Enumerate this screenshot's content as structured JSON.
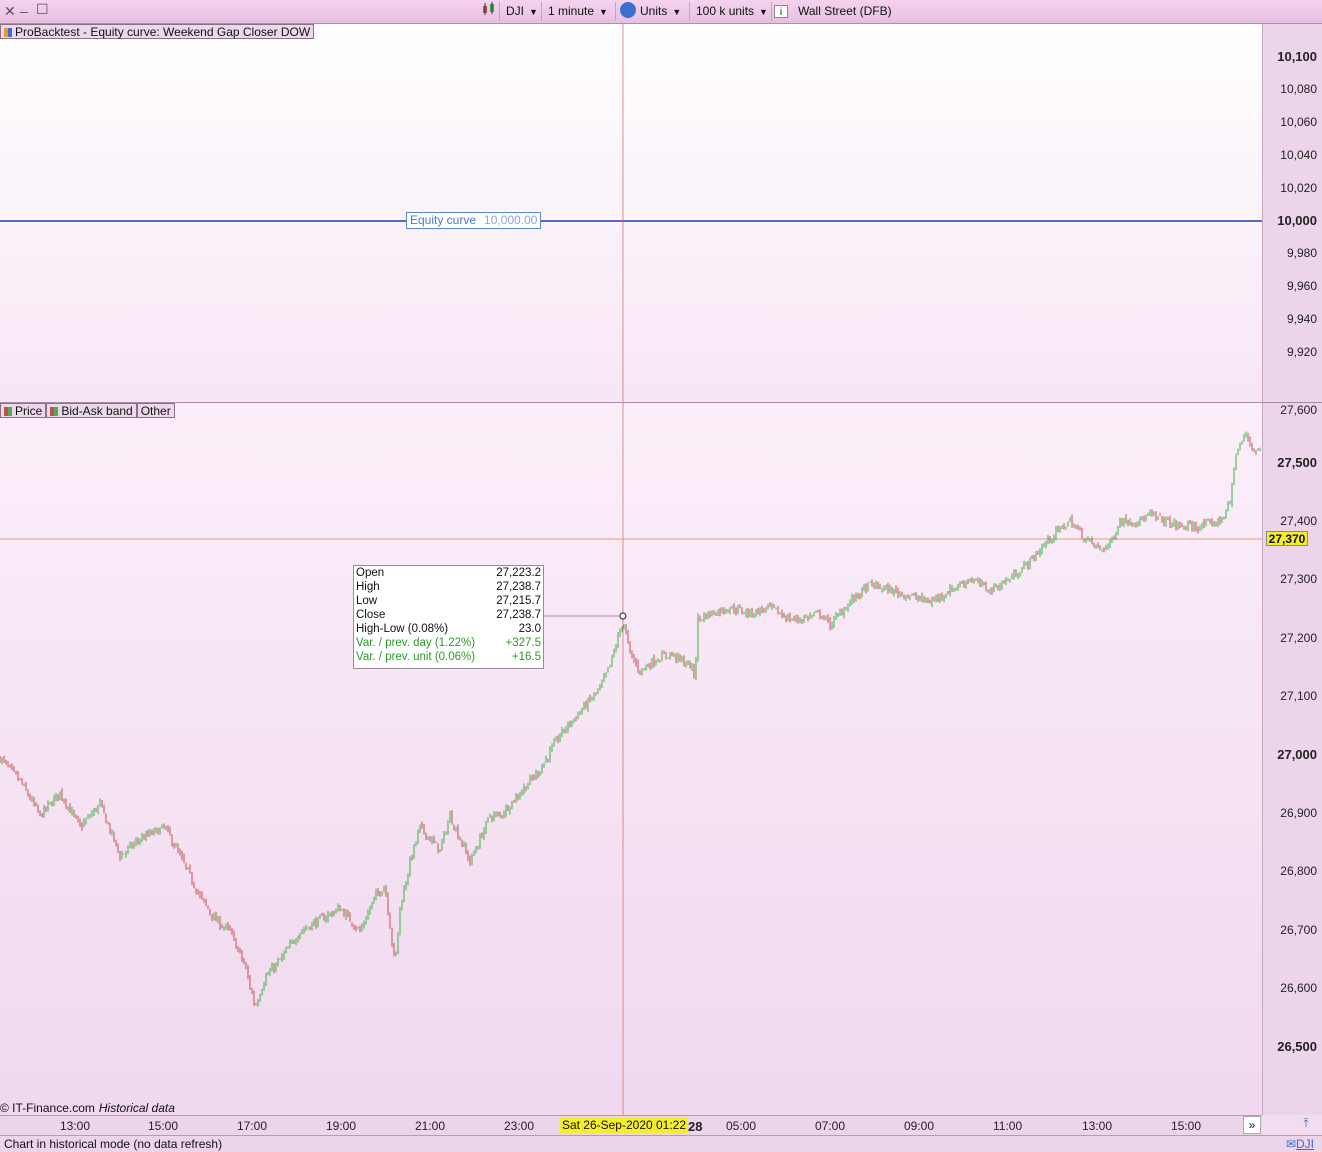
{
  "toolbar": {
    "symbol": "DJI",
    "timeframe": "1 minute",
    "units": "Units",
    "size": "100 k units",
    "info_icon": "info-icon",
    "instrument": "Wall Street (DFB)"
  },
  "upper_panel": {
    "label": "ProBacktest - Equity curve: Weekend Gap Closer DOW",
    "equity_label": "Equity curve",
    "equity_value": "10,000.00",
    "yticks": [
      {
        "label": "10,100",
        "bold": true
      },
      {
        "label": "10,080",
        "bold": false
      },
      {
        "label": "10,060",
        "bold": false
      },
      {
        "label": "10,040",
        "bold": false
      },
      {
        "label": "10,020",
        "bold": false
      },
      {
        "label": "10,000",
        "bold": true
      },
      {
        "label": "9,980",
        "bold": false
      },
      {
        "label": "9,960",
        "bold": false
      },
      {
        "label": "9,940",
        "bold": false
      },
      {
        "label": "9,920",
        "bold": false
      }
    ]
  },
  "lower_panel": {
    "tabs": [
      "Price",
      "Bid-Ask band",
      "Other"
    ],
    "yticks": [
      {
        "label": "27,600",
        "bold": false
      },
      {
        "label": "27,500",
        "bold": true
      },
      {
        "label": "27,400",
        "bold": false
      },
      {
        "label": "27,300",
        "bold": false
      },
      {
        "label": "27,200",
        "bold": false
      },
      {
        "label": "27,100",
        "bold": false
      },
      {
        "label": "27,000",
        "bold": true
      },
      {
        "label": "26,900",
        "bold": false
      },
      {
        "label": "26,800",
        "bold": false
      },
      {
        "label": "26,700",
        "bold": false
      },
      {
        "label": "26,600",
        "bold": false
      },
      {
        "label": "26,500",
        "bold": true
      }
    ],
    "current_price": "27,370"
  },
  "tooltip": {
    "rows": [
      {
        "label": "Open",
        "value": "27,223.2",
        "green": false
      },
      {
        "label": "High",
        "value": "27,238.7",
        "green": false
      },
      {
        "label": "Low",
        "value": "27,215.7",
        "green": false
      },
      {
        "label": "Close",
        "value": "27,238.7",
        "green": false
      },
      {
        "label": "High-Low (0.08%)",
        "value": "23.0",
        "green": false
      },
      {
        "label": "Var. / prev. day (1.22%)",
        "value": "+327.5",
        "green": true
      },
      {
        "label": "Var. / prev. unit (0.06%)",
        "value": "+16.5",
        "green": true
      }
    ]
  },
  "time_axis": {
    "ticks": [
      "13:00",
      "15:00",
      "17:00",
      "19:00",
      "21:00",
      "23:00",
      "28",
      "05:00",
      "07:00",
      "09:00",
      "11:00",
      "13:00",
      "15:00"
    ],
    "cursor_date": "Sat 26-Sep-2020 01:22"
  },
  "credit": {
    "source": "© IT-Finance.com",
    "mode": "Historical data"
  },
  "status": {
    "text": "Chart in historical mode (no data refresh)",
    "right_label": "DJI"
  },
  "colors": {
    "up": "#3cb043",
    "down": "#c0504d",
    "equity": "#1f3fb0",
    "crosshair": "#e07070",
    "price_line": "#e0a080",
    "tag": "#f4ee2a"
  },
  "chart_data": {
    "type": "line",
    "y_range": [
      26450,
      27650
    ],
    "anchors": [
      [
        0,
        27000
      ],
      [
        20,
        26960
      ],
      [
        40,
        26900
      ],
      [
        60,
        26940
      ],
      [
        80,
        26880
      ],
      [
        100,
        26920
      ],
      [
        120,
        26830
      ],
      [
        140,
        26860
      ],
      [
        165,
        26880
      ],
      [
        180,
        26830
      ],
      [
        200,
        26760
      ],
      [
        215,
        26720
      ],
      [
        230,
        26700
      ],
      [
        245,
        26640
      ],
      [
        255,
        26570
      ],
      [
        265,
        26620
      ],
      [
        280,
        26650
      ],
      [
        300,
        26700
      ],
      [
        320,
        26720
      ],
      [
        340,
        26740
      ],
      [
        360,
        26700
      ],
      [
        375,
        26760
      ],
      [
        385,
        26780
      ],
      [
        395,
        26640
      ],
      [
        400,
        26740
      ],
      [
        410,
        26820
      ],
      [
        420,
        26880
      ],
      [
        440,
        26840
      ],
      [
        450,
        26900
      ],
      [
        460,
        26860
      ],
      [
        470,
        26820
      ],
      [
        480,
        26860
      ],
      [
        490,
        26900
      ],
      [
        500,
        26900
      ],
      [
        520,
        26940
      ],
      [
        540,
        26980
      ],
      [
        560,
        27040
      ],
      [
        580,
        27080
      ],
      [
        600,
        27120
      ],
      [
        610,
        27160
      ],
      [
        623,
        27238
      ],
      [
        630,
        27180
      ],
      [
        640,
        27150
      ],
      [
        655,
        27170
      ],
      [
        670,
        27180
      ],
      [
        690,
        27160
      ],
      [
        695,
        27140
      ],
      [
        698,
        27240
      ],
      [
        710,
        27250
      ],
      [
        730,
        27260
      ],
      [
        750,
        27250
      ],
      [
        770,
        27260
      ],
      [
        790,
        27240
      ],
      [
        800,
        27240
      ],
      [
        820,
        27250
      ],
      [
        830,
        27230
      ],
      [
        850,
        27270
      ],
      [
        870,
        27300
      ],
      [
        890,
        27290
      ],
      [
        910,
        27280
      ],
      [
        930,
        27270
      ],
      [
        950,
        27290
      ],
      [
        970,
        27310
      ],
      [
        990,
        27290
      ],
      [
        1010,
        27310
      ],
      [
        1030,
        27340
      ],
      [
        1050,
        27380
      ],
      [
        1070,
        27410
      ],
      [
        1085,
        27380
      ],
      [
        1100,
        27360
      ],
      [
        1110,
        27370
      ],
      [
        1120,
        27410
      ],
      [
        1140,
        27410
      ],
      [
        1150,
        27420
      ],
      [
        1165,
        27410
      ],
      [
        1180,
        27400
      ],
      [
        1200,
        27400
      ],
      [
        1220,
        27410
      ],
      [
        1230,
        27440
      ],
      [
        1235,
        27520
      ],
      [
        1245,
        27560
      ],
      [
        1255,
        27530
      ],
      [
        1262,
        27540
      ]
    ]
  }
}
